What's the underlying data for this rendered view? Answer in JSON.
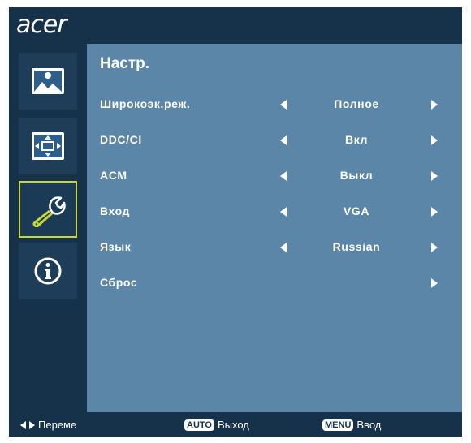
{
  "brand": "acer",
  "sidebar": {
    "items": [
      {
        "name": "picture",
        "icon": "picture-icon"
      },
      {
        "name": "position",
        "icon": "position-icon"
      },
      {
        "name": "setup",
        "icon": "wrench-icon",
        "active": true
      },
      {
        "name": "information",
        "icon": "info-icon"
      }
    ]
  },
  "main": {
    "title": "Настр.",
    "rows": [
      {
        "label": "Широкоэк.реж.",
        "value": "Полное",
        "has_left": true,
        "has_right": true
      },
      {
        "label": "DDC/CI",
        "value": "Вкл",
        "has_left": true,
        "has_right": true
      },
      {
        "label": "ACM",
        "value": "Выкл",
        "has_left": true,
        "has_right": true
      },
      {
        "label": "Вход",
        "value": "VGA",
        "has_left": true,
        "has_right": true
      },
      {
        "label": "Язык",
        "value": "Russian",
        "has_left": true,
        "has_right": true
      },
      {
        "label": "Сброс",
        "value": "",
        "has_left": false,
        "has_right": true
      }
    ]
  },
  "footer": {
    "move_label": "Переме",
    "auto_badge": "AUTO",
    "exit_label": "Выход",
    "menu_badge": "MENU",
    "enter_label": "Ввод"
  },
  "colors": {
    "frame": "#15324a",
    "panel": "#5b86a7",
    "active_outline": "#c7d63a"
  }
}
